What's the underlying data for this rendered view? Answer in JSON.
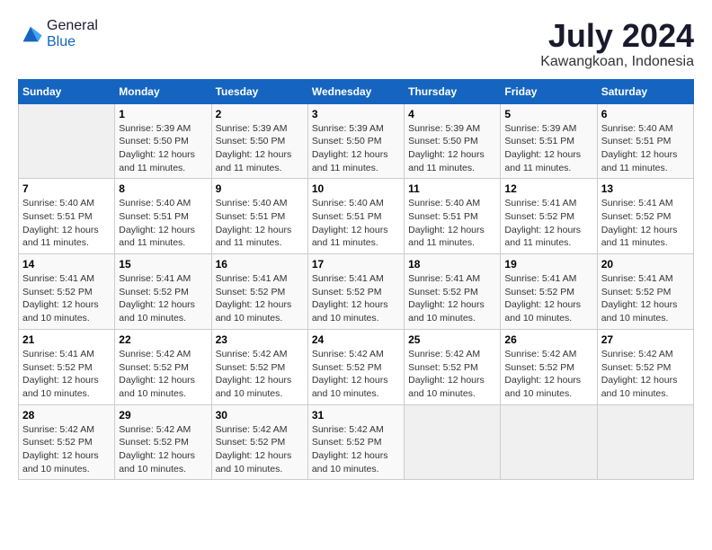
{
  "logo": {
    "general": "General",
    "blue": "Blue"
  },
  "header": {
    "month_year": "July 2024",
    "location": "Kawangkoan, Indonesia"
  },
  "days_of_week": [
    "Sunday",
    "Monday",
    "Tuesday",
    "Wednesday",
    "Thursday",
    "Friday",
    "Saturday"
  ],
  "weeks": [
    [
      {
        "day": "",
        "info": ""
      },
      {
        "day": "1",
        "info": "Sunrise: 5:39 AM\nSunset: 5:50 PM\nDaylight: 12 hours\nand 11 minutes."
      },
      {
        "day": "2",
        "info": "Sunrise: 5:39 AM\nSunset: 5:50 PM\nDaylight: 12 hours\nand 11 minutes."
      },
      {
        "day": "3",
        "info": "Sunrise: 5:39 AM\nSunset: 5:50 PM\nDaylight: 12 hours\nand 11 minutes."
      },
      {
        "day": "4",
        "info": "Sunrise: 5:39 AM\nSunset: 5:50 PM\nDaylight: 12 hours\nand 11 minutes."
      },
      {
        "day": "5",
        "info": "Sunrise: 5:39 AM\nSunset: 5:51 PM\nDaylight: 12 hours\nand 11 minutes."
      },
      {
        "day": "6",
        "info": "Sunrise: 5:40 AM\nSunset: 5:51 PM\nDaylight: 12 hours\nand 11 minutes."
      }
    ],
    [
      {
        "day": "7",
        "info": ""
      },
      {
        "day": "8",
        "info": "Sunrise: 5:40 AM\nSunset: 5:51 PM\nDaylight: 12 hours\nand 11 minutes."
      },
      {
        "day": "9",
        "info": "Sunrise: 5:40 AM\nSunset: 5:51 PM\nDaylight: 12 hours\nand 11 minutes."
      },
      {
        "day": "10",
        "info": "Sunrise: 5:40 AM\nSunset: 5:51 PM\nDaylight: 12 hours\nand 11 minutes."
      },
      {
        "day": "11",
        "info": "Sunrise: 5:40 AM\nSunset: 5:51 PM\nDaylight: 12 hours\nand 11 minutes."
      },
      {
        "day": "12",
        "info": "Sunrise: 5:41 AM\nSunset: 5:52 PM\nDaylight: 12 hours\nand 11 minutes."
      },
      {
        "day": "13",
        "info": "Sunrise: 5:41 AM\nSunset: 5:52 PM\nDaylight: 12 hours\nand 11 minutes."
      }
    ],
    [
      {
        "day": "14",
        "info": ""
      },
      {
        "day": "15",
        "info": "Sunrise: 5:41 AM\nSunset: 5:52 PM\nDaylight: 12 hours\nand 10 minutes."
      },
      {
        "day": "16",
        "info": "Sunrise: 5:41 AM\nSunset: 5:52 PM\nDaylight: 12 hours\nand 10 minutes."
      },
      {
        "day": "17",
        "info": "Sunrise: 5:41 AM\nSunset: 5:52 PM\nDaylight: 12 hours\nand 10 minutes."
      },
      {
        "day": "18",
        "info": "Sunrise: 5:41 AM\nSunset: 5:52 PM\nDaylight: 12 hours\nand 10 minutes."
      },
      {
        "day": "19",
        "info": "Sunrise: 5:41 AM\nSunset: 5:52 PM\nDaylight: 12 hours\nand 10 minutes."
      },
      {
        "day": "20",
        "info": "Sunrise: 5:41 AM\nSunset: 5:52 PM\nDaylight: 12 hours\nand 10 minutes."
      }
    ],
    [
      {
        "day": "21",
        "info": ""
      },
      {
        "day": "22",
        "info": "Sunrise: 5:42 AM\nSunset: 5:52 PM\nDaylight: 12 hours\nand 10 minutes."
      },
      {
        "day": "23",
        "info": "Sunrise: 5:42 AM\nSunset: 5:52 PM\nDaylight: 12 hours\nand 10 minutes."
      },
      {
        "day": "24",
        "info": "Sunrise: 5:42 AM\nSunset: 5:52 PM\nDaylight: 12 hours\nand 10 minutes."
      },
      {
        "day": "25",
        "info": "Sunrise: 5:42 AM\nSunset: 5:52 PM\nDaylight: 12 hours\nand 10 minutes."
      },
      {
        "day": "26",
        "info": "Sunrise: 5:42 AM\nSunset: 5:52 PM\nDaylight: 12 hours\nand 10 minutes."
      },
      {
        "day": "27",
        "info": "Sunrise: 5:42 AM\nSunset: 5:52 PM\nDaylight: 12 hours\nand 10 minutes."
      }
    ],
    [
      {
        "day": "28",
        "info": ""
      },
      {
        "day": "29",
        "info": "Sunrise: 5:42 AM\nSunset: 5:52 PM\nDaylight: 12 hours\nand 10 minutes."
      },
      {
        "day": "30",
        "info": "Sunrise: 5:42 AM\nSunset: 5:52 PM\nDaylight: 12 hours\nand 10 minutes."
      },
      {
        "day": "31",
        "info": "Sunrise: 5:42 AM\nSunset: 5:52 PM\nDaylight: 12 hours\nand 10 minutes."
      },
      {
        "day": "",
        "info": ""
      },
      {
        "day": "",
        "info": ""
      },
      {
        "day": "",
        "info": ""
      }
    ]
  ],
  "week_sunday_info": {
    "7": "Sunrise: 5:40 AM\nSunset: 5:51 PM\nDaylight: 12 hours\nand 11 minutes.",
    "14": "Sunrise: 5:41 AM\nSunset: 5:52 PM\nDaylight: 12 hours\nand 10 minutes.",
    "21": "Sunrise: 5:41 AM\nSunset: 5:52 PM\nDaylight: 12 hours\nand 10 minutes.",
    "28": "Sunrise: 5:42 AM\nSunset: 5:52 PM\nDaylight: 12 hours\nand 10 minutes."
  }
}
